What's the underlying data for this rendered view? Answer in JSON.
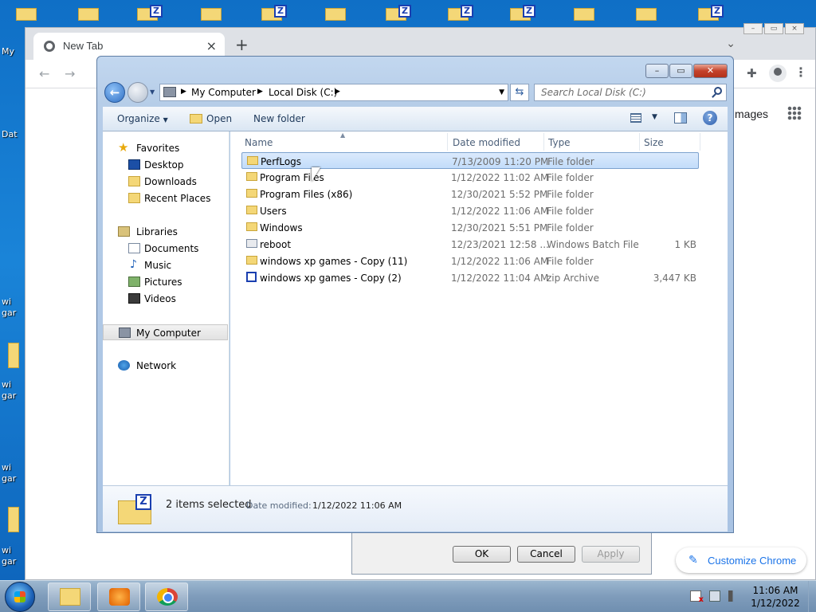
{
  "chrome": {
    "tab_title": "New Tab",
    "tab_close": "×",
    "new_tab": "+",
    "images_link": "mages",
    "customize_label": "Customize Chrome"
  },
  "desktop": {
    "left_labels": [
      "My",
      "Dat",
      "wi",
      "gar",
      "wi",
      "gar",
      "wi",
      "gar",
      "wi",
      "gar"
    ]
  },
  "props_dialog": {
    "ok": "OK",
    "cancel": "Cancel",
    "apply": "Apply"
  },
  "explorer": {
    "address": [
      "My Computer",
      "Local Disk (C:)"
    ],
    "search_placeholder": "Search Local Disk (C:)",
    "cmdbar": {
      "organize": "Organize",
      "open": "Open",
      "new_folder": "New folder"
    },
    "nav": {
      "favorites": "Favorites",
      "desktop": "Desktop",
      "downloads": "Downloads",
      "recent_places": "Recent Places",
      "libraries": "Libraries",
      "documents": "Documents",
      "music": "Music",
      "pictures": "Pictures",
      "videos": "Videos",
      "my_computer": "My Computer",
      "network": "Network"
    },
    "columns": {
      "name": "Name",
      "date": "Date modified",
      "type": "Type",
      "size": "Size"
    },
    "files": [
      {
        "name": "PerfLogs",
        "date": "7/13/2009 11:20 PM",
        "type": "File folder",
        "size": "",
        "icon": "folder",
        "selected": true
      },
      {
        "name": "Program Files",
        "date": "1/12/2022 11:02 AM",
        "type": "File folder",
        "size": "",
        "icon": "folder",
        "selected": false
      },
      {
        "name": "Program Files (x86)",
        "date": "12/30/2021 5:52 PM",
        "type": "File folder",
        "size": "",
        "icon": "folder",
        "selected": false
      },
      {
        "name": "Users",
        "date": "1/12/2022 11:06 AM",
        "type": "File folder",
        "size": "",
        "icon": "folder",
        "selected": false
      },
      {
        "name": "Windows",
        "date": "12/30/2021 5:51 PM",
        "type": "File folder",
        "size": "",
        "icon": "folder",
        "selected": false
      },
      {
        "name": "reboot",
        "date": "12/23/2021 12:58 ...",
        "type": "Windows Batch File",
        "size": "1 KB",
        "icon": "bat",
        "selected": false
      },
      {
        "name": "windows xp games - Copy (11)",
        "date": "1/12/2022 11:06 AM",
        "type": "File folder",
        "size": "",
        "icon": "folder",
        "selected": false
      },
      {
        "name": "windows xp games - Copy (2)",
        "date": "1/12/2022 11:04 AM",
        "type": "zip Archive",
        "size": "3,447 KB",
        "icon": "zip",
        "selected": false
      }
    ],
    "details": {
      "count": "2 items selected",
      "date_label": "Date modified:",
      "date_value": "1/12/2022 11:06 AM"
    }
  },
  "taskbar": {
    "time": "11:06 AM",
    "date": "1/12/2022"
  }
}
